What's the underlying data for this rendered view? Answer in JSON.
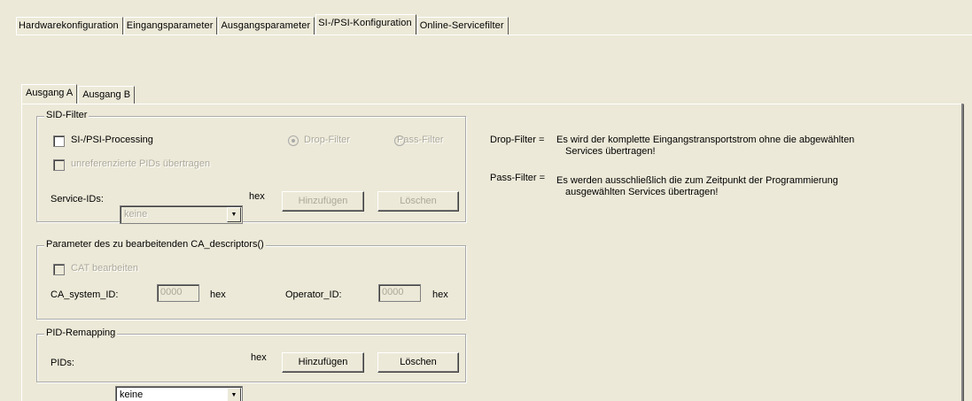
{
  "top_tabs": [
    {
      "label": "Hardwarekonfiguration"
    },
    {
      "label": "Eingangsparameter"
    },
    {
      "label": "Ausgangsparameter"
    },
    {
      "label": "SI-/PSI-Konfiguration"
    },
    {
      "label": "Online-Servicefilter"
    }
  ],
  "output_tabs": [
    {
      "label": "Ausgang A"
    },
    {
      "label": "Ausgang B"
    }
  ],
  "sid_filter": {
    "title": "SID-Filter",
    "si_psi_processing_label": "SI-/PSI-Processing",
    "drop_filter_label": "Drop-Filter",
    "pass_filter_label": "Pass-Filter",
    "unreferenced_pids_label": "unreferenzierte PIDs übertragen",
    "service_ids_label": "Service-IDs:",
    "service_ids_value": "keine",
    "hex_unit": "hex",
    "add_label": "Hinzufügen",
    "delete_label": "Löschen"
  },
  "ca_descriptor": {
    "title": "Parameter des zu bearbeitenden CA_descriptors()",
    "cat_label": "CAT bearbeiten",
    "ca_system_id_label": "CA_system_ID:",
    "ca_system_id_value": "0000",
    "hex_unit_1": "hex",
    "operator_id_label": "Operator_ID:",
    "operator_id_value": "0000",
    "hex_unit_2": "hex"
  },
  "pid_remapping": {
    "title": "PID-Remapping",
    "pids_label": "PIDs:",
    "pids_value": "keine",
    "hex_unit": "hex",
    "add_label": "Hinzufügen",
    "delete_label": "Löschen"
  },
  "help": {
    "drop_term": "Drop-Filter =",
    "drop_line1": "Es wird der komplette Eingangstransportstrom ohne die abgewählten",
    "drop_line2": "Services übertragen!",
    "pass_term": "Pass-Filter =",
    "pass_line1": "Es werden ausschließlich die zum Zeitpunkt der Programmierung",
    "pass_line2": "ausgewählten Services übertragen!"
  }
}
